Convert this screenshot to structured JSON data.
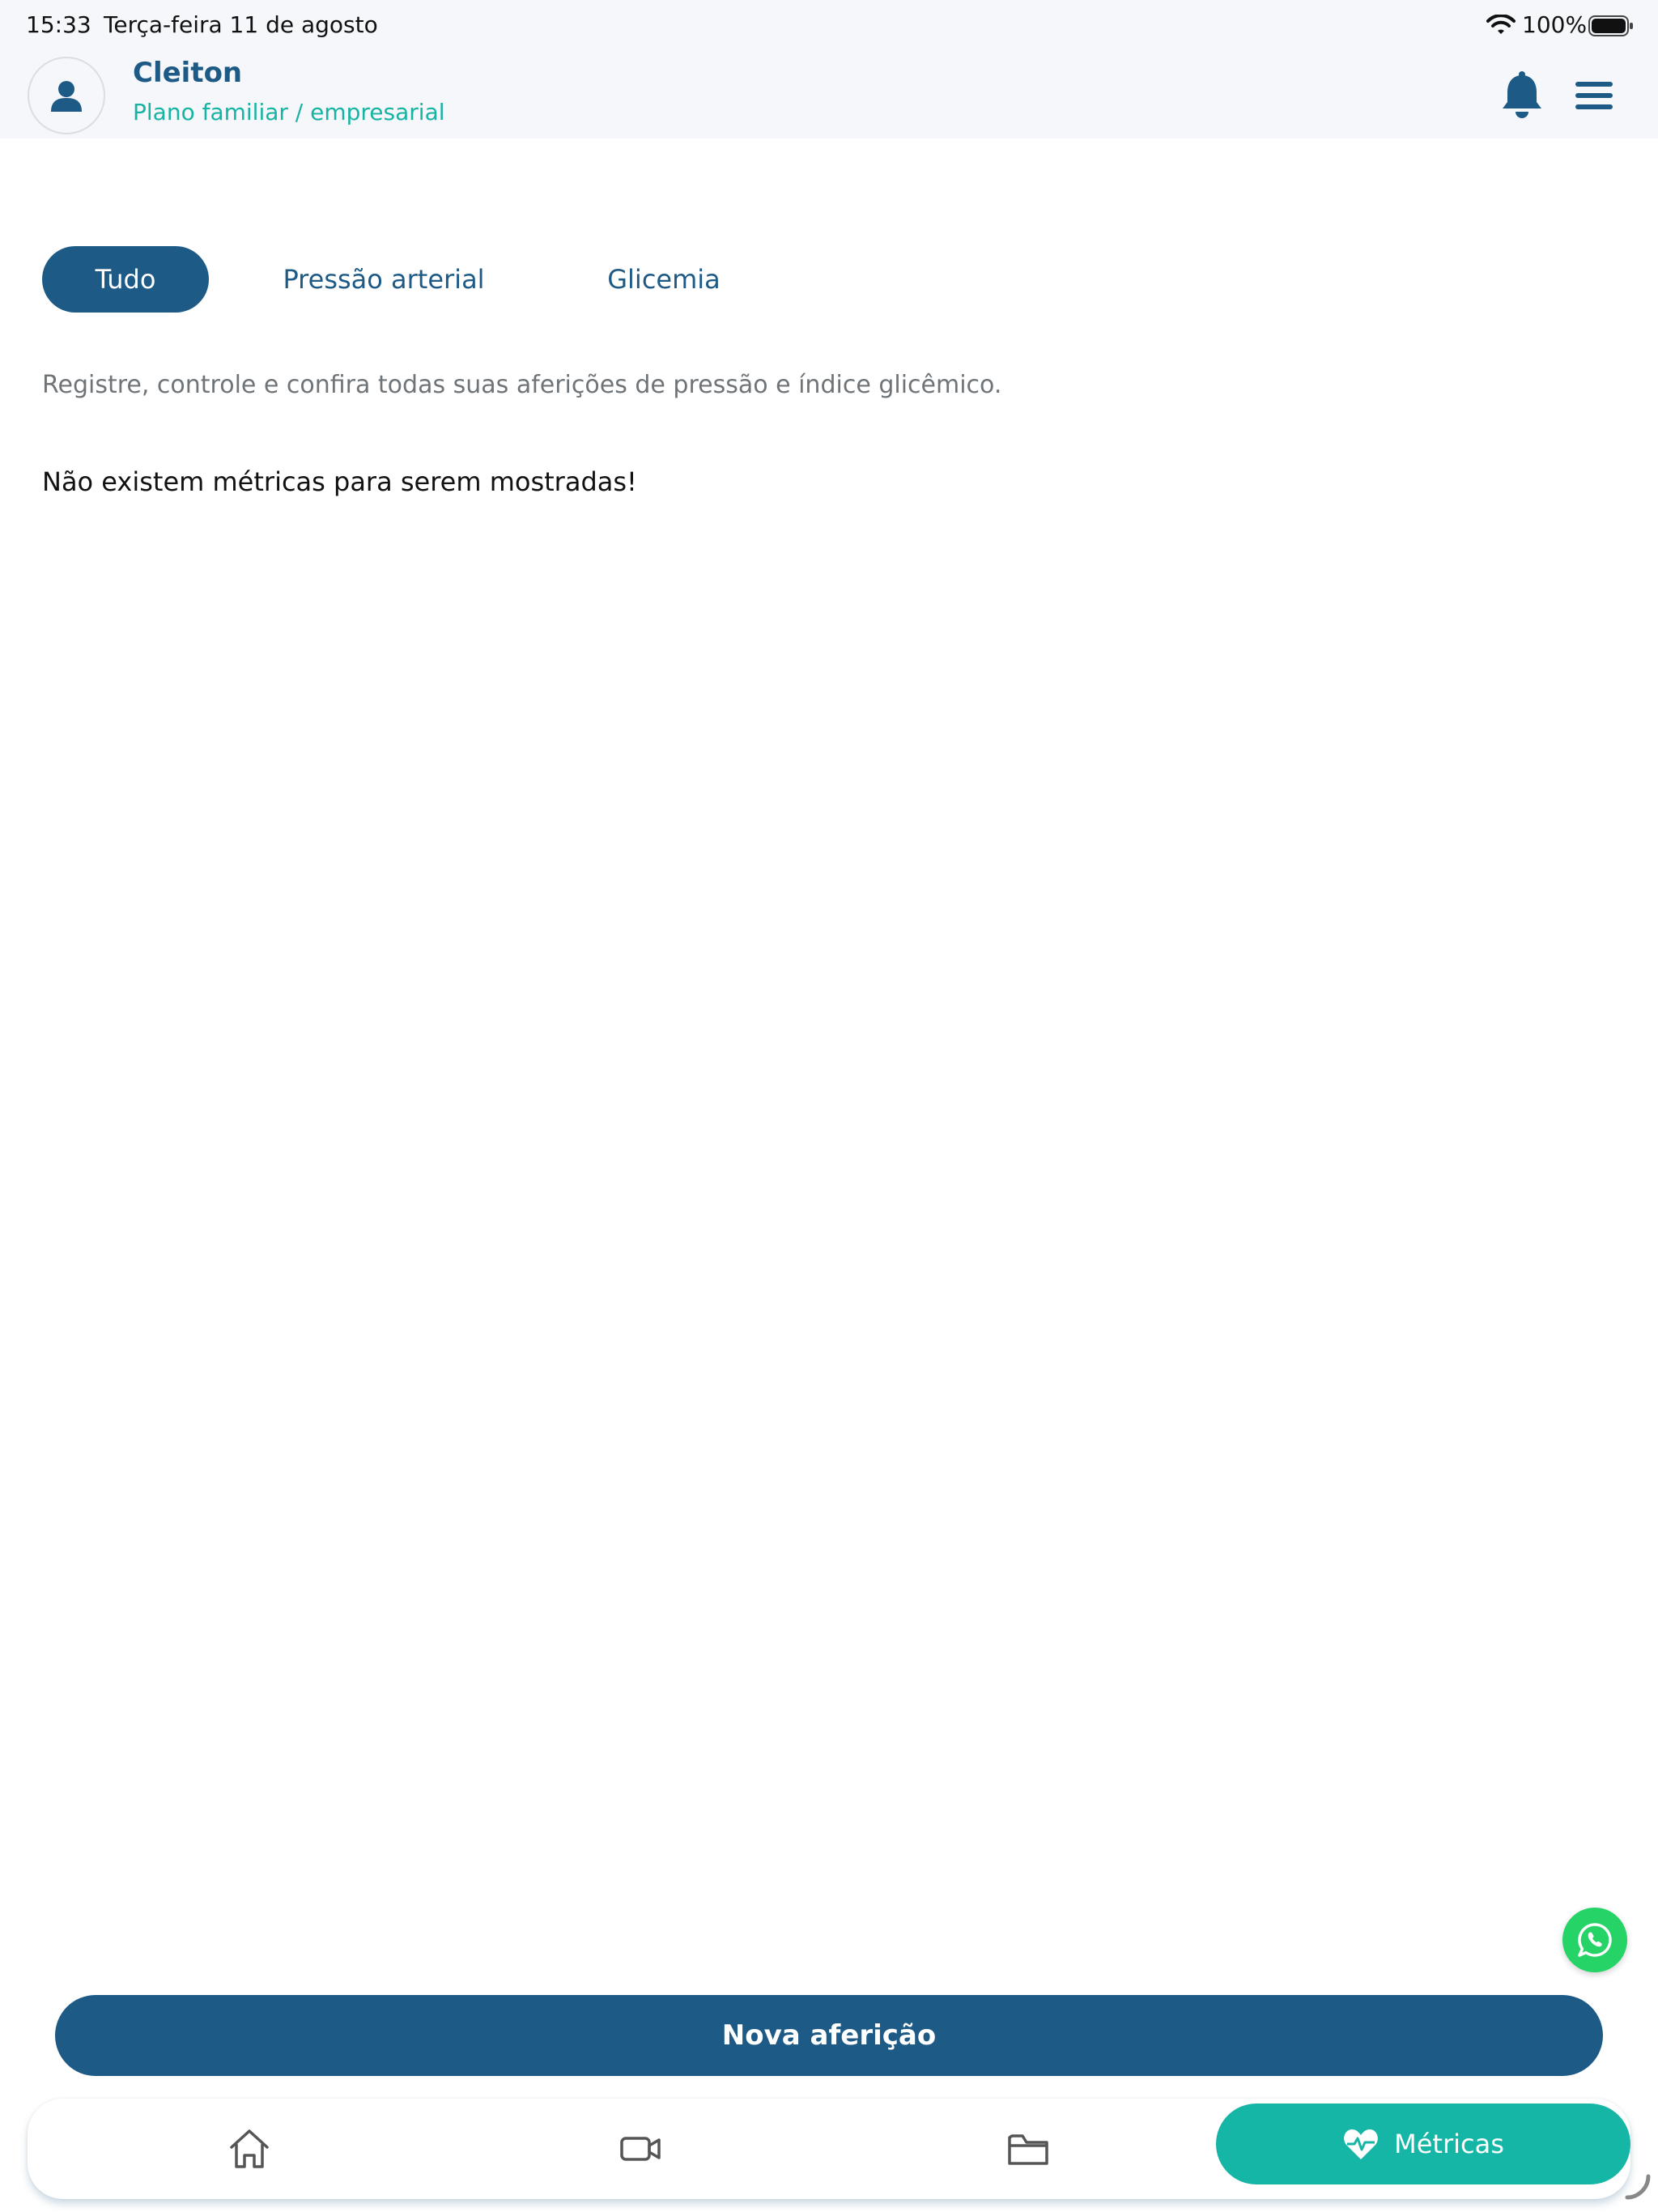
{
  "status_bar": {
    "time": "15:33",
    "date": "Terça-feira 11 de agosto",
    "battery": "100%",
    "icons": [
      "wifi-icon",
      "battery-icon"
    ]
  },
  "header": {
    "user_name": "Cleiton",
    "plan": "Plano familiar / empresarial",
    "icons": [
      "user-icon",
      "bell-icon",
      "menu-icon"
    ]
  },
  "tabs": [
    {
      "label": "Tudo",
      "active": true
    },
    {
      "label": "Pressão arterial",
      "active": false
    },
    {
      "label": "Glicemia",
      "active": false
    }
  ],
  "intro_text": "Registre, controle e confira todas suas aferições de pressão e índice glicêmico.",
  "empty_message": "Não existem métricas para serem mostradas!",
  "actions": {
    "new_measurement": "Nova aferição"
  },
  "bottom_nav": {
    "items": [
      {
        "icon": "home-icon",
        "label": ""
      },
      {
        "icon": "video-icon",
        "label": ""
      },
      {
        "icon": "folder-icon",
        "label": ""
      },
      {
        "icon": "heart-pulse-icon",
        "label": "Métricas",
        "active": true
      }
    ]
  },
  "colors": {
    "primary": "#1e5a86",
    "accent": "#15b6a6",
    "whatsapp": "#25d366",
    "header_bg": "#f5f7fa"
  }
}
